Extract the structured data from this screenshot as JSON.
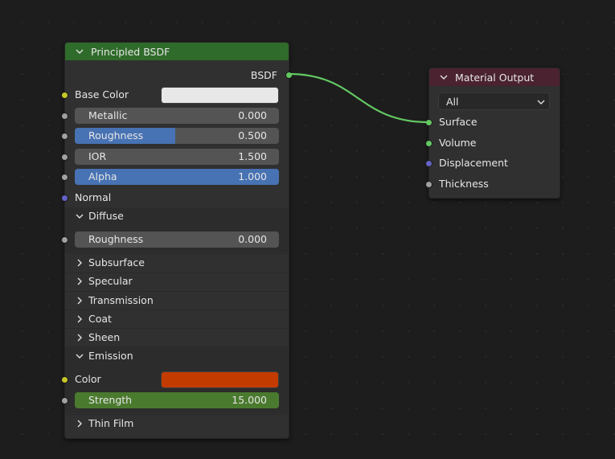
{
  "colors": {
    "bsdf_header": "#2f6b2a",
    "output_header": "#4a2230",
    "socket_color": "#c7c729",
    "socket_float": "#a1a1a1",
    "socket_vector": "#6363c7",
    "socket_shader": "#63c763",
    "slider_fill": "#4772b3",
    "base_color_value": "#e8e8e8",
    "emission_color_value": "#c43b00",
    "strength_fill": "#4a7a2e",
    "link": "#63c763"
  },
  "bsdf_node": {
    "title": "Principled BSDF",
    "output_label": "BSDF",
    "base_color_label": "Base Color",
    "metallic": {
      "label": "Metallic",
      "value": "0.000"
    },
    "roughness": {
      "label": "Roughness",
      "value": "0.500"
    },
    "ior": {
      "label": "IOR",
      "value": "1.500"
    },
    "alpha": {
      "label": "Alpha",
      "value": "1.000"
    },
    "normal_label": "Normal",
    "diffuse": {
      "label": "Diffuse",
      "roughness_label": "Roughness",
      "roughness_value": "0.000"
    },
    "panels": [
      "Subsurface",
      "Specular",
      "Transmission",
      "Coat",
      "Sheen"
    ],
    "emission": {
      "label": "Emission",
      "color_label": "Color",
      "strength_label": "Strength",
      "strength_value": "15.000"
    },
    "thin_film_label": "Thin Film"
  },
  "output_node": {
    "title": "Material Output",
    "target": "All",
    "inputs": [
      "Surface",
      "Volume",
      "Displacement",
      "Thickness"
    ]
  }
}
